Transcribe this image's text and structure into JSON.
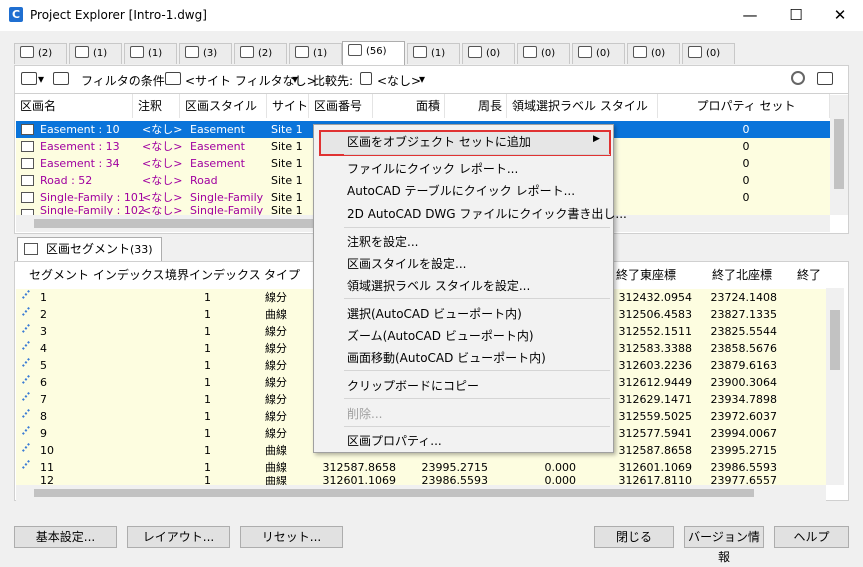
{
  "window": {
    "title": "Project Explorer [Intro-1.dwg]",
    "app_icon": "C",
    "minimize": "—",
    "maximize": "☐",
    "close": "✕"
  },
  "tabs": [
    {
      "count": "(2)"
    },
    {
      "count": "(1)"
    },
    {
      "count": "(1)"
    },
    {
      "count": "(3)"
    },
    {
      "count": "(2)"
    },
    {
      "count": "(1)"
    },
    {
      "count": "(56)"
    },
    {
      "count": "(1)"
    },
    {
      "count": "(0)"
    },
    {
      "count": "(0)"
    },
    {
      "count": "(0)"
    },
    {
      "count": "(0)"
    },
    {
      "count": "(0)"
    }
  ],
  "filterbar": {
    "filter_label": "フィルタの条件:",
    "filter_value": "<サイト フィルタなし>",
    "compare_label": "比較先:",
    "compare_value": "<なし>",
    "dropdown": "▾"
  },
  "grid1": {
    "headers": [
      "区画名",
      "注釈",
      "区画スタイル",
      "サイト",
      "区画番号",
      "面積",
      "周長",
      "領域選択ラベル スタイル",
      "プロパティ セット"
    ],
    "rows": [
      {
        "name": "Easement : 10",
        "note": "<なし>",
        "style": "Easement",
        "site": "Site 1",
        "prop": "0"
      },
      {
        "name": "Easement : 13",
        "note": "<なし>",
        "style": "Easement",
        "site": "Site 1",
        "prop": "0"
      },
      {
        "name": "Easement : 34",
        "note": "<なし>",
        "style": "Easement",
        "site": "Site 1",
        "prop": "0"
      },
      {
        "name": "Road : 52",
        "note": "<なし>",
        "style": "Road",
        "site": "Site 1",
        "prop": "0"
      },
      {
        "name": "Single-Family : 101",
        "note": "<なし>",
        "style": "Single-Family",
        "site": "Site 1",
        "prop": "0"
      },
      {
        "name": "Single-Family : 102",
        "note": "<なし>",
        "style": "Single-Family",
        "site": "Site 1",
        "prop": "0"
      }
    ]
  },
  "segments": {
    "tab_label": "区画セグメント",
    "tab_count": "(33)",
    "headers": [
      "セグメント インデックス",
      "境界インデックス",
      "タイプ",
      "終了東座標",
      "終了北座標",
      "終了"
    ],
    "rows": [
      {
        "i": "1",
        "b": "1",
        "t": "線分",
        "ea": "",
        "na": "",
        "l": "",
        "e": "312432.0954",
        "n": "23724.1408"
      },
      {
        "i": "2",
        "b": "1",
        "t": "曲線",
        "ea": "",
        "na": "",
        "l": "",
        "e": "312506.4583",
        "n": "23827.1335"
      },
      {
        "i": "3",
        "b": "1",
        "t": "線分",
        "ea": "",
        "na": "",
        "l": "",
        "e": "312552.1511",
        "n": "23825.5544"
      },
      {
        "i": "4",
        "b": "1",
        "t": "線分",
        "ea": "",
        "na": "",
        "l": "",
        "e": "312583.3388",
        "n": "23858.5676"
      },
      {
        "i": "5",
        "b": "1",
        "t": "線分",
        "ea": "",
        "na": "",
        "l": "",
        "e": "312603.2236",
        "n": "23879.6163"
      },
      {
        "i": "6",
        "b": "1",
        "t": "線分",
        "ea": "",
        "na": "",
        "l": "",
        "e": "312612.9449",
        "n": "23900.3064"
      },
      {
        "i": "7",
        "b": "1",
        "t": "線分",
        "ea": "",
        "na": "",
        "l": "",
        "e": "312629.1471",
        "n": "23934.7898"
      },
      {
        "i": "8",
        "b": "1",
        "t": "線分",
        "ea": "",
        "na": "",
        "l": "",
        "e": "312559.5025",
        "n": "23972.6037"
      },
      {
        "i": "9",
        "b": "1",
        "t": "線分",
        "ea": "",
        "na": "",
        "l": "",
        "e": "312577.5941",
        "n": "23994.0067"
      },
      {
        "i": "10",
        "b": "1",
        "t": "曲線",
        "ea": "",
        "na": "",
        "l": "",
        "e": "312587.8658",
        "n": "23995.2715"
      },
      {
        "i": "11",
        "b": "1",
        "t": "曲線",
        "ea": "312587.8658",
        "na": "23995.2715",
        "l": "0.000",
        "e": "312601.1069",
        "n": "23986.5593"
      },
      {
        "i": "12",
        "b": "1",
        "t": "曲線",
        "ea": "312601.1069",
        "na": "23986.5593",
        "l": "0.000",
        "e": "312617.8110",
        "n": "23977.6557"
      }
    ]
  },
  "context_menu": [
    "区画をオブジェクト セットに追加",
    "ファイルにクイック レポート...",
    "AutoCAD テーブルにクイック レポート...",
    "2D AutoCAD DWG ファイルにクイック書き出し...",
    "注釈を設定...",
    "区画スタイルを設定...",
    "領域選択ラベル スタイルを設定...",
    "選択(AutoCAD ビューポート内)",
    "ズーム(AutoCAD ビューポート内)",
    "画面移動(AutoCAD ビューポート内)",
    "クリップボードにコピー",
    "削除...",
    "区画プロパティ..."
  ],
  "submenu_arrow": "▶",
  "buttons": {
    "settings": "基本設定...",
    "layout": "レイアウト...",
    "reset": "リセット...",
    "close": "閉じる",
    "version": "バージョン情報",
    "help": "ヘルプ"
  }
}
